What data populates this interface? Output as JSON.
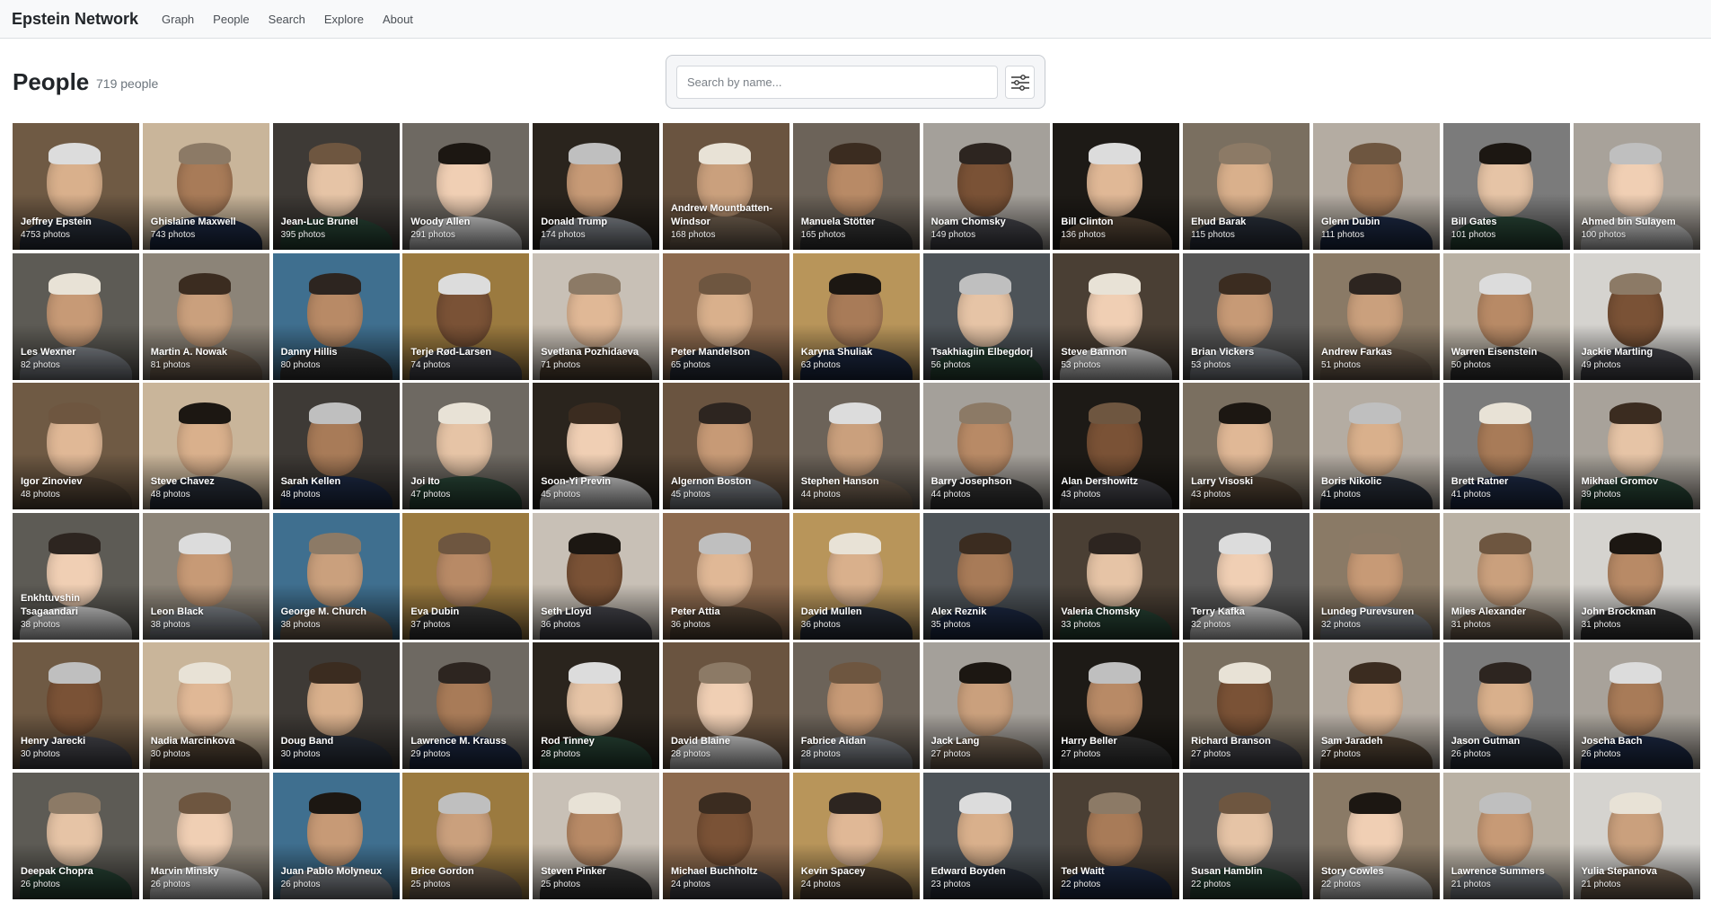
{
  "nav": {
    "brand": "Epstein Network",
    "links": [
      "Graph",
      "People",
      "Search",
      "Explore",
      "About"
    ]
  },
  "header": {
    "title": "People",
    "count": "719 people"
  },
  "search": {
    "placeholder": "Search by name...",
    "value": ""
  },
  "people": [
    {
      "name": "Jeffrey Epstein",
      "photos": "4753 photos"
    },
    {
      "name": "Ghislaine Maxwell",
      "photos": "743 photos"
    },
    {
      "name": "Jean-Luc Brunel",
      "photos": "395 photos"
    },
    {
      "name": "Woody Allen",
      "photos": "291 photos"
    },
    {
      "name": "Donald Trump",
      "photos": "174 photos"
    },
    {
      "name": "Andrew Mountbatten-Windsor",
      "photos": "168 photos"
    },
    {
      "name": "Manuela Stötter",
      "photos": "165 photos"
    },
    {
      "name": "Noam Chomsky",
      "photos": "149 photos"
    },
    {
      "name": "Bill Clinton",
      "photos": "136 photos"
    },
    {
      "name": "Ehud Barak",
      "photos": "115 photos"
    },
    {
      "name": "Glenn Dubin",
      "photos": "111 photos"
    },
    {
      "name": "Bill Gates",
      "photos": "101 photos"
    },
    {
      "name": "Ahmed bin Sulayem",
      "photos": "100 photos"
    },
    {
      "name": "Les Wexner",
      "photos": "82 photos"
    },
    {
      "name": "Martin A. Nowak",
      "photos": "81 photos"
    },
    {
      "name": "Danny Hillis",
      "photos": "80 photos"
    },
    {
      "name": "Terje Rød-Larsen",
      "photos": "74 photos"
    },
    {
      "name": "Svetlana Pozhidaeva",
      "photos": "71 photos"
    },
    {
      "name": "Peter Mandelson",
      "photos": "65 photos"
    },
    {
      "name": "Karyna Shuliak",
      "photos": "63 photos"
    },
    {
      "name": "Tsakhiagiin Elbegdorj",
      "photos": "56 photos"
    },
    {
      "name": "Steve Bannon",
      "photos": "53 photos"
    },
    {
      "name": "Brian Vickers",
      "photos": "53 photos"
    },
    {
      "name": "Andrew Farkas",
      "photos": "51 photos"
    },
    {
      "name": "Warren Eisenstein",
      "photos": "50 photos"
    },
    {
      "name": "Jackie Martling",
      "photos": "49 photos"
    },
    {
      "name": "Igor Zinoviev",
      "photos": "48 photos"
    },
    {
      "name": "Steve Chavez",
      "photos": "48 photos"
    },
    {
      "name": "Sarah Kellen",
      "photos": "48 photos"
    },
    {
      "name": "Joi Ito",
      "photos": "47 photos"
    },
    {
      "name": "Soon-Yi Previn",
      "photos": "45 photos"
    },
    {
      "name": "Algernon Boston",
      "photos": "45 photos"
    },
    {
      "name": "Stephen Hanson",
      "photos": "44 photos"
    },
    {
      "name": "Barry Josephson",
      "photos": "44 photos"
    },
    {
      "name": "Alan Dershowitz",
      "photos": "43 photos"
    },
    {
      "name": "Larry Visoski",
      "photos": "43 photos"
    },
    {
      "name": "Boris Nikolic",
      "photos": "41 photos"
    },
    {
      "name": "Brett Ratner",
      "photos": "41 photos"
    },
    {
      "name": "Mikhael Gromov",
      "photos": "39 photos"
    },
    {
      "name": "Enkhtuvshin Tsagaandari",
      "photos": "38 photos"
    },
    {
      "name": "Leon Black",
      "photos": "38 photos"
    },
    {
      "name": "George M. Church",
      "photos": "38 photos"
    },
    {
      "name": "Eva Dubin",
      "photos": "37 photos"
    },
    {
      "name": "Seth Lloyd",
      "photos": "36 photos"
    },
    {
      "name": "Peter Attia",
      "photos": "36 photos"
    },
    {
      "name": "David Mullen",
      "photos": "36 photos"
    },
    {
      "name": "Alex Reznik",
      "photos": "35 photos"
    },
    {
      "name": "Valeria Chomsky",
      "photos": "33 photos"
    },
    {
      "name": "Terry Kafka",
      "photos": "32 photos"
    },
    {
      "name": "Lundeg Purevsuren",
      "photos": "32 photos"
    },
    {
      "name": "Miles Alexander",
      "photos": "31 photos"
    },
    {
      "name": "John Brockman",
      "photos": "31 photos"
    },
    {
      "name": "Henry Jarecki",
      "photos": "30 photos"
    },
    {
      "name": "Nadia Marcinkova",
      "photos": "30 photos"
    },
    {
      "name": "Doug Band",
      "photos": "30 photos"
    },
    {
      "name": "Lawrence M. Krauss",
      "photos": "29 photos"
    },
    {
      "name": "Rod Tinney",
      "photos": "28 photos"
    },
    {
      "name": "David Blaine",
      "photos": "28 photos"
    },
    {
      "name": "Fabrice Aidan",
      "photos": "28 photos"
    },
    {
      "name": "Jack Lang",
      "photos": "27 photos"
    },
    {
      "name": "Harry Beller",
      "photos": "27 photos"
    },
    {
      "name": "Richard Branson",
      "photos": "27 photos"
    },
    {
      "name": "Sam Jaradeh",
      "photos": "27 photos"
    },
    {
      "name": "Jason Gutman",
      "photos": "26 photos"
    },
    {
      "name": "Joscha Bach",
      "photos": "26 photos"
    },
    {
      "name": "Deepak Chopra",
      "photos": "26 photos"
    },
    {
      "name": "Marvin Minsky",
      "photos": "26 photos"
    },
    {
      "name": "Juan Pablo Molyneux",
      "photos": "26 photos"
    },
    {
      "name": "Brice Gordon",
      "photos": "25 photos"
    },
    {
      "name": "Steven Pinker",
      "photos": "25 photos"
    },
    {
      "name": "Michael Buchholtz",
      "photos": "24 photos"
    },
    {
      "name": "Kevin Spacey",
      "photos": "24 photos"
    },
    {
      "name": "Edward Boyden",
      "photos": "23 photos"
    },
    {
      "name": "Ted Waitt",
      "photos": "22 photos"
    },
    {
      "name": "Susan Hamblin",
      "photos": "22 photos"
    },
    {
      "name": "Story Cowles",
      "photos": "22 photos"
    },
    {
      "name": "Lawrence Summers",
      "photos": "21 photos"
    },
    {
      "name": "Yulia Stepanova",
      "photos": "21 photos"
    }
  ]
}
